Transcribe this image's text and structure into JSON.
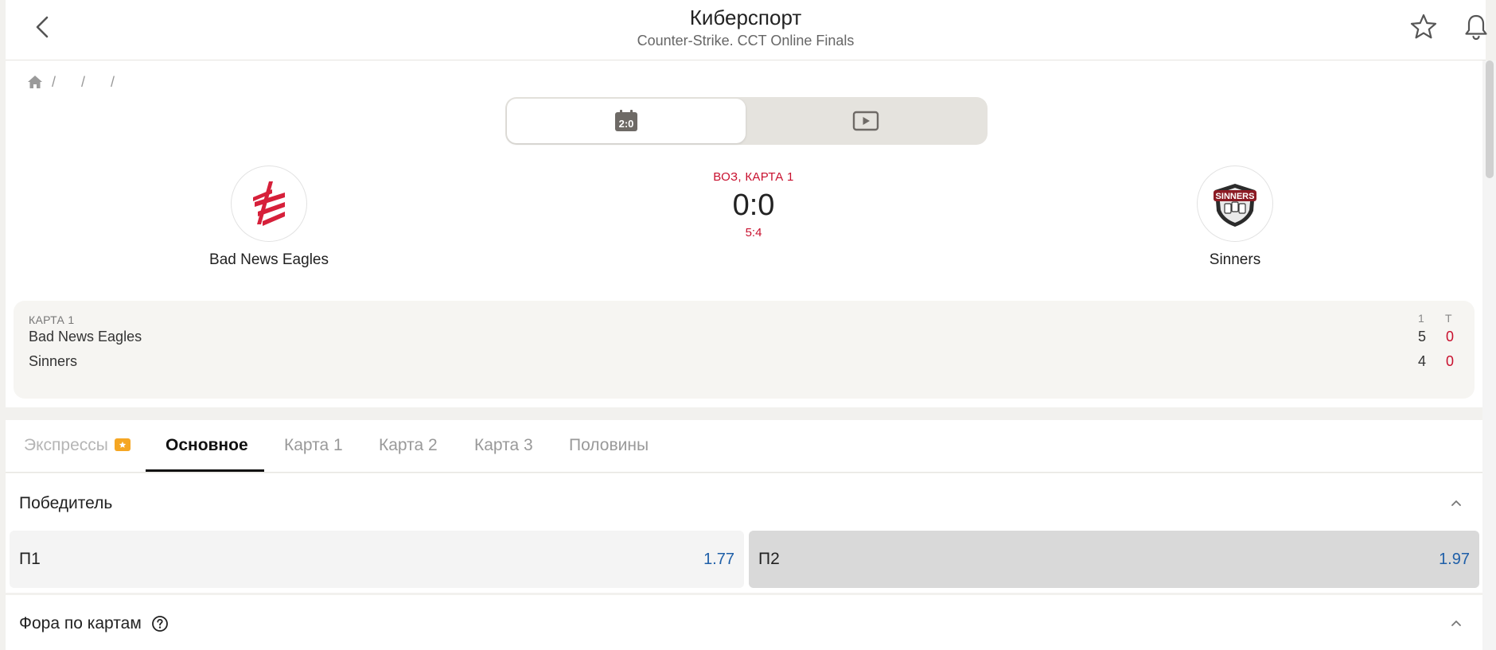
{
  "header": {
    "title": "Киберспорт",
    "subtitle": "Counter-Strike. CCT Online Finals"
  },
  "breadcrumb": [
    "",
    "",
    ""
  ],
  "view_toggle": {
    "active": "scoreboard"
  },
  "match": {
    "team1": {
      "name": "Bad News Eagles",
      "logo": "bad-news-eagles-logo"
    },
    "team2": {
      "name": "Sinners",
      "logo": "sinners-logo"
    },
    "period": "ВОЗ, КАРТА 1",
    "score": "0:0",
    "round_score": "5:4"
  },
  "stats": {
    "header": "КАРТА 1",
    "columns": [
      "1",
      "Т"
    ],
    "rows": [
      {
        "team": "Bad News Eagles",
        "values": [
          "5",
          "0"
        ]
      },
      {
        "team": "Sinners",
        "values": [
          "4",
          "0"
        ]
      }
    ]
  },
  "tabs": [
    {
      "label": "Экспрессы",
      "icon": "ticket-icon"
    },
    {
      "label": "Основное",
      "active": true
    },
    {
      "label": "Карта 1"
    },
    {
      "label": "Карта 2"
    },
    {
      "label": "Карта 3"
    },
    {
      "label": "Половины"
    }
  ],
  "markets": {
    "winner": {
      "title": "Победитель",
      "outcomes": [
        {
          "label": "П1",
          "odds": "1.77"
        },
        {
          "label": "П2",
          "odds": "1.97"
        }
      ]
    },
    "map_handicap": {
      "title": "Фора по картам"
    }
  },
  "colors": {
    "accent_red": "#c8102e",
    "odds_blue": "#1f5fa8",
    "ticket_orange": "#f5a623"
  }
}
